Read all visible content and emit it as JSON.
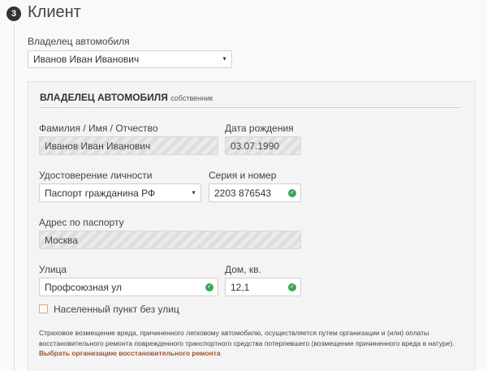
{
  "step": {
    "number": "3",
    "title": "Клиент"
  },
  "owner_select": {
    "label": "Владелец автомобиля",
    "value": "Иванов Иван Иванович"
  },
  "panel": {
    "heading": "ВЛАДЕЛЕЦ АВТОМОБИЛЯ",
    "subheading": "собственник",
    "fio": {
      "label": "Фамилия / Имя / Отчество",
      "value": "Иванов Иван Иванович"
    },
    "birth": {
      "label": "Дата рождения",
      "value": "03.07.1990"
    },
    "id_doc": {
      "label": "Удостоверение личности",
      "value": "Паспорт гражданина РФ"
    },
    "series": {
      "label": "Серия и номер",
      "value": "2203 876543"
    },
    "address": {
      "label": "Адрес по паспорту",
      "value": "Москва"
    },
    "street": {
      "label": "Улица",
      "value": "Профсоюзная ул"
    },
    "house": {
      "label": "Дом, кв.",
      "value": "12,1"
    },
    "no_streets": {
      "label": "Населенный пункт без улиц",
      "checked": false
    },
    "note": {
      "text": "Страховое возмещение вреда, причиненного легковому автомобилю, осуществляется путем организации и (или) оплаты восстановительного ремонта поврежденного транспортного средства потерпевшего (возмещение причиненного вреда в натуре).",
      "link": "Выбрать организацию восстановительного ремонта"
    }
  },
  "colors": {
    "accent": "#e0a560",
    "ok": "#3aa657",
    "link": "#a0522d"
  },
  "icons": {
    "valid": "check-circle-icon",
    "dropdown": "caret-down-icon"
  }
}
